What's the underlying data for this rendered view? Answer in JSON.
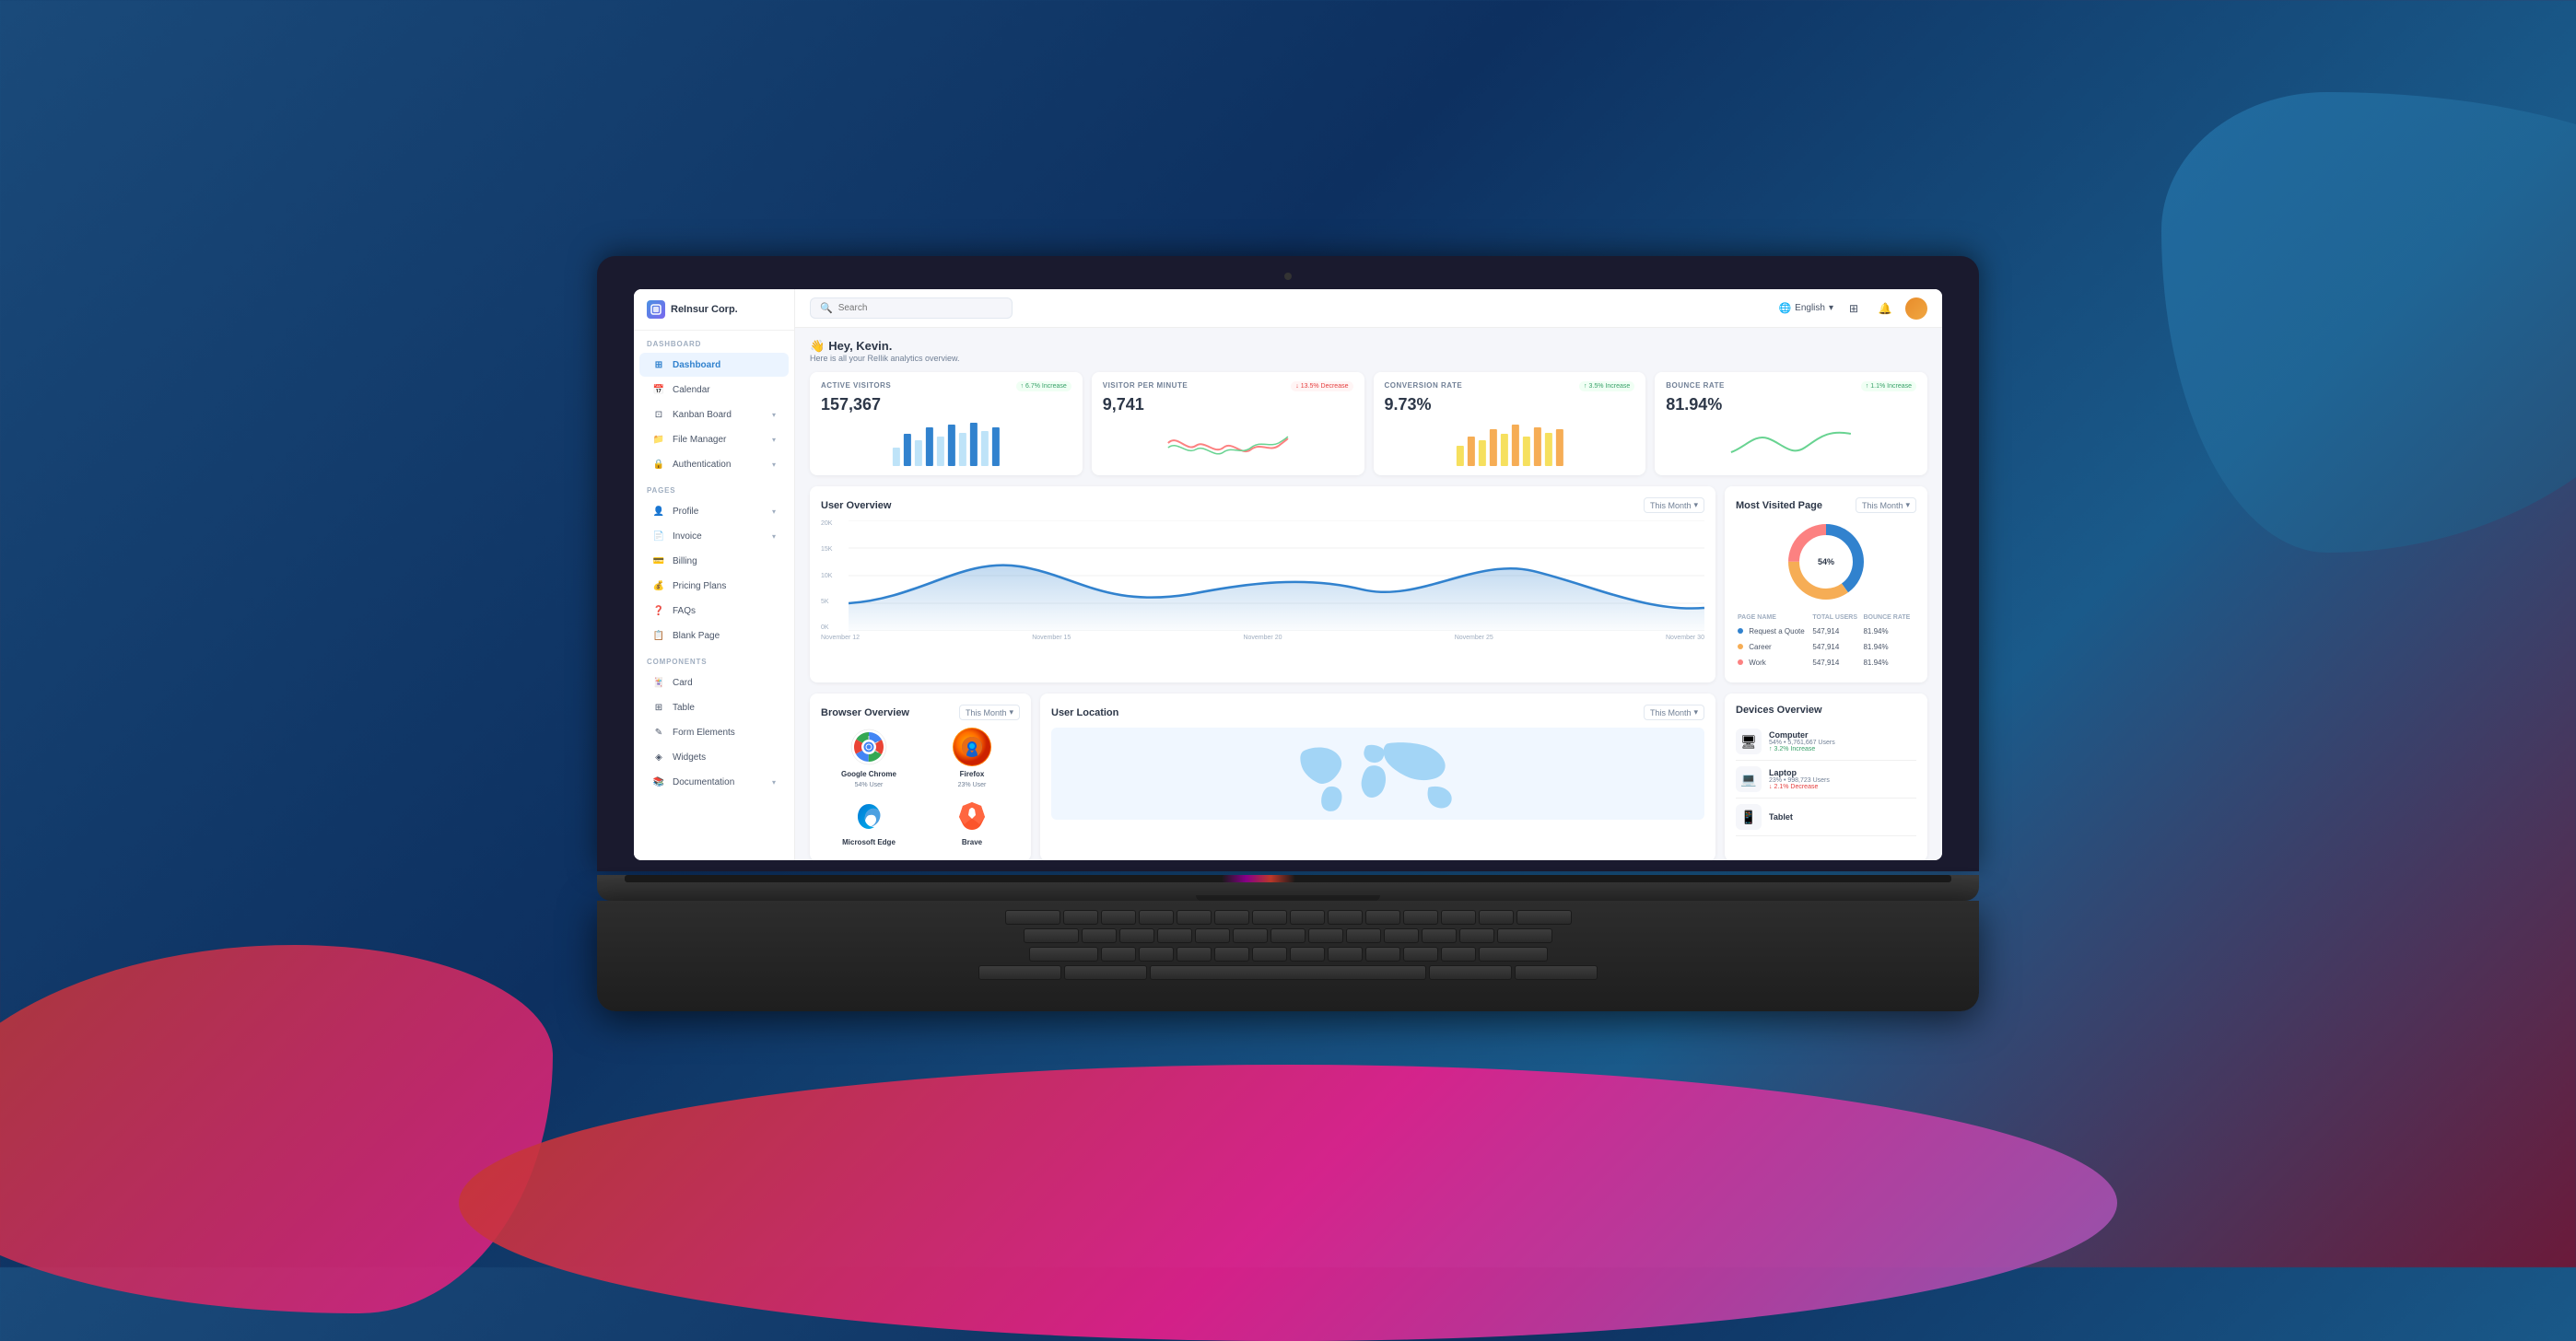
{
  "background": {
    "gradient_start": "#1a4a7a",
    "gradient_end": "#6b1a3a"
  },
  "app": {
    "name": "ReInsur Corp.",
    "logo_icon": "R"
  },
  "topnav": {
    "search_placeholder": "Search",
    "language": "English",
    "language_chevron": "▾"
  },
  "sidebar": {
    "dashboard_label": "DASHBOARD",
    "items_section1": [
      {
        "label": "Dashboard",
        "active": true
      },
      {
        "label": "Calendar"
      },
      {
        "label": "Kanban Board"
      },
      {
        "label": "File Manager"
      },
      {
        "label": "Authentication"
      }
    ],
    "pages_label": "PAGES",
    "items_section2": [
      {
        "label": "Profile"
      },
      {
        "label": "Invoice"
      },
      {
        "label": "Billing"
      },
      {
        "label": "Pricing Plans"
      },
      {
        "label": "FAQs"
      },
      {
        "label": "Blank Page"
      }
    ],
    "components_label": "COMPONENTS",
    "items_section3": [
      {
        "label": "Card"
      },
      {
        "label": "Table"
      },
      {
        "label": "Form Elements"
      },
      {
        "label": "Widgets"
      },
      {
        "label": "Documentation"
      }
    ]
  },
  "greeting": {
    "wave": "👋",
    "title": "Hey, Kevin.",
    "subtitle": "Here is all your ReIlik analytics overview."
  },
  "stats": [
    {
      "label": "ACTIVE VISITORS",
      "value": "157,367",
      "badge_text": "6.7% Increase",
      "badge_type": "green",
      "badge_arrow": "↑",
      "bars": [
        30,
        50,
        40,
        70,
        55,
        80,
        65,
        90,
        60,
        75
      ]
    },
    {
      "label": "VISITOR PER MINUTE",
      "value": "9,741",
      "badge_text": "13.5% Decrease",
      "badge_type": "red",
      "badge_arrow": "↓",
      "line_type": "sparkline_red"
    },
    {
      "label": "CONVERSION RATE",
      "value": "9.73%",
      "badge_text": "3.5% Increase",
      "badge_type": "green",
      "badge_arrow": "↑",
      "bars_amber": [
        40,
        65,
        55,
        80,
        70,
        90,
        60,
        85,
        75,
        95
      ]
    },
    {
      "label": "BOUNCE RATE",
      "value": "81.94%",
      "badge_text": "1.1% Increase",
      "badge_type": "green",
      "badge_arrow": "↑",
      "line_type": "sparkline_green"
    }
  ],
  "user_overview": {
    "title": "User Overview",
    "period": "This Month",
    "x_labels": [
      "November 12",
      "November 15",
      "November 20",
      "November 25",
      "November 30"
    ],
    "y_labels": [
      "20K",
      "15K",
      "10K",
      "5K",
      "0K"
    ],
    "chart_color": "#3182ce"
  },
  "most_visited": {
    "title": "Most Visited Page",
    "period": "This Month",
    "donut": {
      "segments": [
        {
          "color": "#3182ce",
          "pct": 40
        },
        {
          "color": "#f6ad55",
          "pct": 35
        },
        {
          "color": "#fc8181",
          "pct": 25
        }
      ]
    },
    "table": {
      "headers": [
        "PAGE NAME",
        "TOTAL USERS",
        "BOUNCE RATE"
      ],
      "rows": [
        {
          "dot_color": "#3182ce",
          "name": "Request a Quote",
          "users": "547,914",
          "rate": "81.94%"
        },
        {
          "dot_color": "#f6ad55",
          "name": "Career",
          "users": "547,914",
          "rate": "81.94%"
        },
        {
          "dot_color": "#fc8181",
          "name": "Work",
          "users": "547,914",
          "rate": "81.94%"
        }
      ]
    }
  },
  "browser_overview": {
    "title": "Browser Overview",
    "period": "This Month",
    "browsers": [
      {
        "name": "Google Chrome",
        "pct_label": "54% User",
        "icon": "chrome"
      },
      {
        "name": "Firefox",
        "pct_label": "23% User",
        "icon": "firefox"
      },
      {
        "name": "Microsoft Edge",
        "pct_label": "",
        "icon": "edge"
      },
      {
        "name": "Brave",
        "pct_label": "",
        "icon": "brave"
      }
    ]
  },
  "user_location": {
    "title": "User Location",
    "period": "This Month"
  },
  "devices_overview": {
    "title": "Devices Overview",
    "devices": [
      {
        "name": "Computer",
        "stats": "54% • 5,761,667 Users",
        "change": "3.2% Increase",
        "change_type": "up",
        "icon": "🖥"
      },
      {
        "name": "Laptop",
        "stats": "23% • 998,723 Users",
        "change": "2.1% Decrease",
        "change_type": "down",
        "icon": "💻"
      },
      {
        "name": "Tablet",
        "stats": "",
        "change": "",
        "change_type": "up",
        "icon": "📱"
      }
    ]
  }
}
